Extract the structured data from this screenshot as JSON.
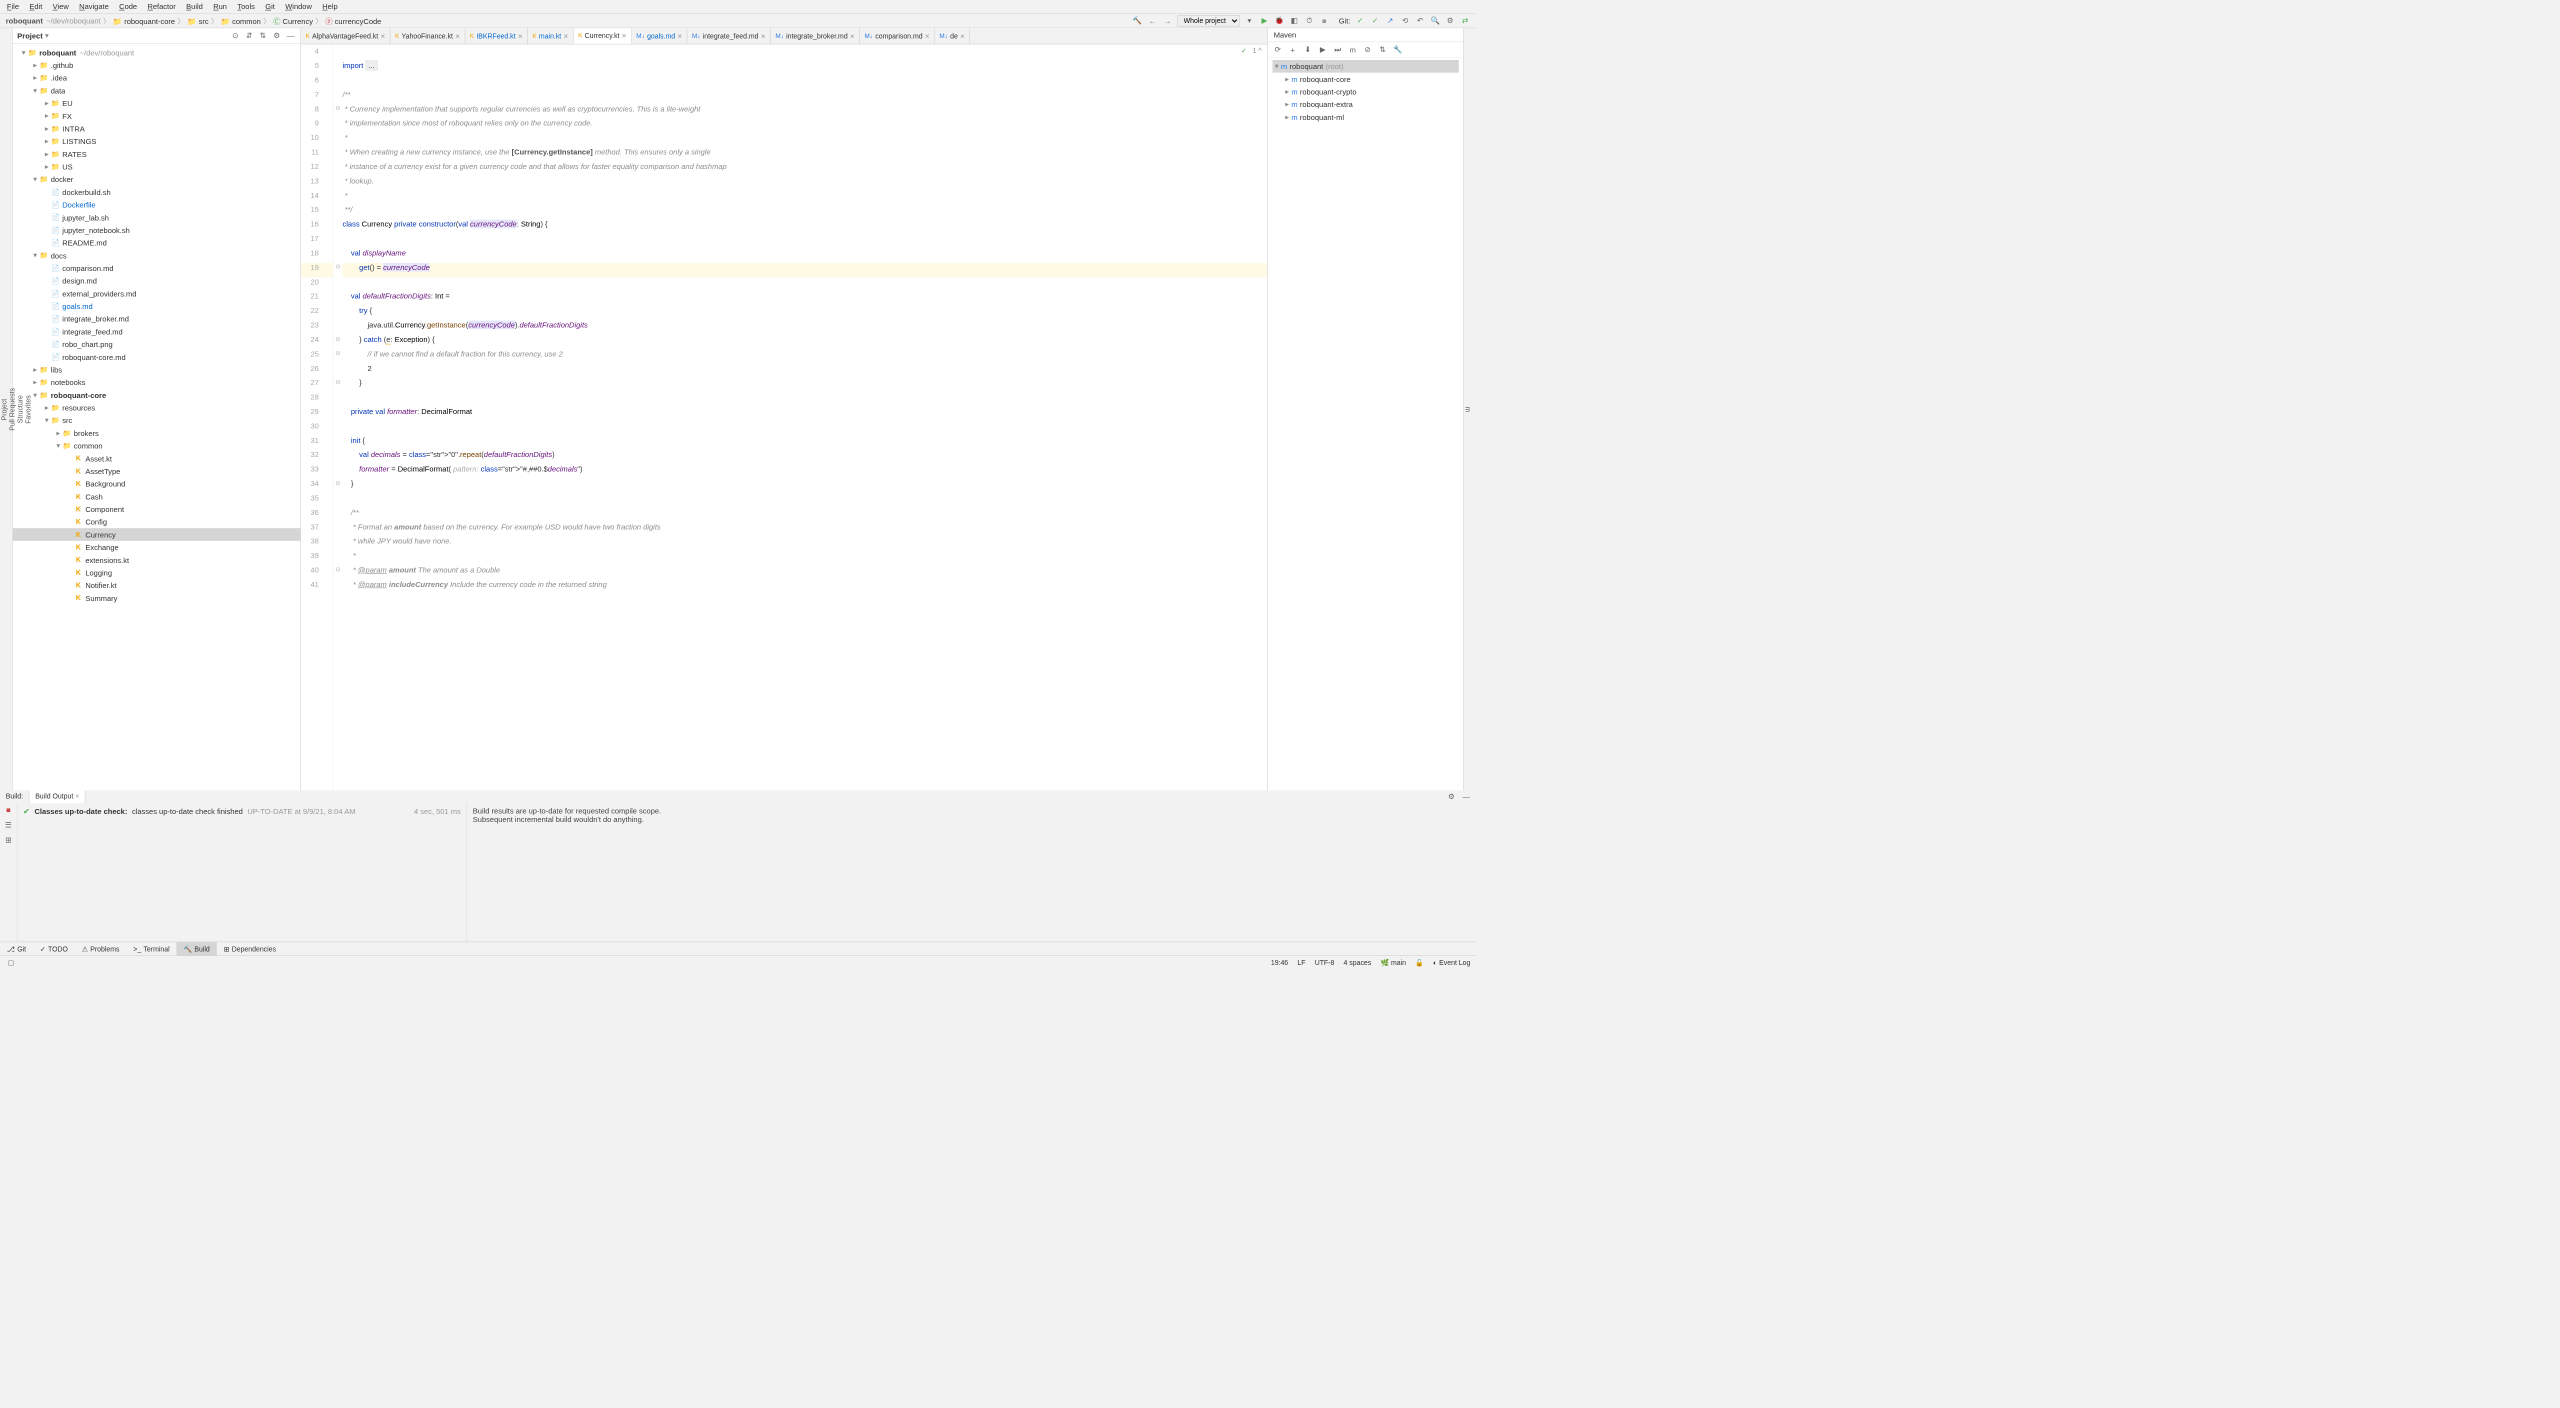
{
  "menu": [
    "File",
    "Edit",
    "View",
    "Navigate",
    "Code",
    "Refactor",
    "Build",
    "Run",
    "Tools",
    "Git",
    "Window",
    "Help"
  ],
  "breadcrumbs": {
    "root": "roboquant",
    "path": "~/dev/roboquant",
    "parts": [
      "roboquant-core",
      "src",
      "common",
      "Currency",
      "currencyCode"
    ]
  },
  "scope": "Whole project",
  "project": {
    "title": "Project",
    "tree": [
      {
        "d": 0,
        "c": "▾",
        "i": "📁",
        "n": "roboquant",
        "suf": "~/dev/roboquant",
        "bold": true
      },
      {
        "d": 1,
        "c": "▸",
        "i": "📁",
        "n": ".github"
      },
      {
        "d": 1,
        "c": "▸",
        "i": "📁",
        "n": ".idea"
      },
      {
        "d": 1,
        "c": "▾",
        "i": "📁",
        "n": "data"
      },
      {
        "d": 2,
        "c": "▸",
        "i": "📁",
        "n": "EU"
      },
      {
        "d": 2,
        "c": "▸",
        "i": "📁",
        "n": "FX"
      },
      {
        "d": 2,
        "c": "▸",
        "i": "📁",
        "n": "INTRA"
      },
      {
        "d": 2,
        "c": "▸",
        "i": "📁",
        "n": "LISTINGS"
      },
      {
        "d": 2,
        "c": "▸",
        "i": "📁",
        "n": "RATES"
      },
      {
        "d": 2,
        "c": "▸",
        "i": "📁",
        "n": "US"
      },
      {
        "d": 1,
        "c": "▾",
        "i": "📁",
        "n": "docker"
      },
      {
        "d": 2,
        "c": "",
        "i": "📄",
        "n": "dockerbuild.sh"
      },
      {
        "d": 2,
        "c": "",
        "i": "📄",
        "n": "Dockerfile",
        "hl": true
      },
      {
        "d": 2,
        "c": "",
        "i": "📄",
        "n": "jupyter_lab.sh"
      },
      {
        "d": 2,
        "c": "",
        "i": "📄",
        "n": "jupyter_notebook.sh"
      },
      {
        "d": 2,
        "c": "",
        "i": "📄",
        "n": "README.md"
      },
      {
        "d": 1,
        "c": "▾",
        "i": "📁",
        "n": "docs"
      },
      {
        "d": 2,
        "c": "",
        "i": "📄",
        "n": "comparison.md"
      },
      {
        "d": 2,
        "c": "",
        "i": "📄",
        "n": "design.md"
      },
      {
        "d": 2,
        "c": "",
        "i": "📄",
        "n": "external_providers.md"
      },
      {
        "d": 2,
        "c": "",
        "i": "📄",
        "n": "goals.md",
        "hl": true
      },
      {
        "d": 2,
        "c": "",
        "i": "📄",
        "n": "integrate_broker.md"
      },
      {
        "d": 2,
        "c": "",
        "i": "📄",
        "n": "integrate_feed.md"
      },
      {
        "d": 2,
        "c": "",
        "i": "📄",
        "n": "robo_chart.png"
      },
      {
        "d": 2,
        "c": "",
        "i": "📄",
        "n": "roboquant-core.md"
      },
      {
        "d": 1,
        "c": "▸",
        "i": "📁",
        "n": "libs"
      },
      {
        "d": 1,
        "c": "▸",
        "i": "📁",
        "n": "notebooks"
      },
      {
        "d": 1,
        "c": "▾",
        "i": "📁",
        "n": "roboquant-core",
        "bold": true
      },
      {
        "d": 2,
        "c": "▸",
        "i": "📁",
        "n": "resources"
      },
      {
        "d": 2,
        "c": "▾",
        "i": "📁",
        "n": "src"
      },
      {
        "d": 3,
        "c": "▸",
        "i": "📁",
        "n": "brokers"
      },
      {
        "d": 3,
        "c": "▾",
        "i": "📁",
        "n": "common"
      },
      {
        "d": 4,
        "c": "",
        "i": "K",
        "n": "Asset.kt"
      },
      {
        "d": 4,
        "c": "",
        "i": "K",
        "n": "AssetType"
      },
      {
        "d": 4,
        "c": "",
        "i": "K",
        "n": "Background"
      },
      {
        "d": 4,
        "c": "",
        "i": "K",
        "n": "Cash"
      },
      {
        "d": 4,
        "c": "",
        "i": "K",
        "n": "Component"
      },
      {
        "d": 4,
        "c": "",
        "i": "K",
        "n": "Config"
      },
      {
        "d": 4,
        "c": "",
        "i": "K",
        "n": "Currency",
        "sel": true
      },
      {
        "d": 4,
        "c": "",
        "i": "K",
        "n": "Exchange"
      },
      {
        "d": 4,
        "c": "",
        "i": "K",
        "n": "extensions.kt"
      },
      {
        "d": 4,
        "c": "",
        "i": "K",
        "n": "Logging"
      },
      {
        "d": 4,
        "c": "",
        "i": "K",
        "n": "Notifier.kt"
      },
      {
        "d": 4,
        "c": "",
        "i": "K",
        "n": "Summary"
      }
    ]
  },
  "tabs": [
    {
      "name": "AlphaVantageFeed.kt",
      "icon": "K"
    },
    {
      "name": "YahooFinance.kt",
      "icon": "K"
    },
    {
      "name": "IBKRFeed.kt",
      "icon": "K",
      "mod": true
    },
    {
      "name": "main.kt",
      "icon": "K",
      "mod": true
    },
    {
      "name": "Currency.kt",
      "icon": "K",
      "active": true
    },
    {
      "name": "goals.md",
      "icon": "M",
      "mod": true
    },
    {
      "name": "integrate_feed.md",
      "icon": "M"
    },
    {
      "name": "integrate_broker.md",
      "icon": "M"
    },
    {
      "name": "comparison.md",
      "icon": "M"
    },
    {
      "name": "de",
      "icon": "M"
    }
  ],
  "editor_status": {
    "checks": "1 ^",
    "hints": "✓"
  },
  "code_start": 4,
  "code_current": 19,
  "code": [
    "",
    "import ...",
    "",
    "/**",
    " * Currency implementation that supports regular currencies as well as cryptocurrencies. This is a lite-weight",
    " * implementation since most of roboquant relies only on the currency code.",
    " *",
    " * When creating a new currency instance, use the [Currency.getInstance] method. This ensures only a single",
    " * instance of a currency exist for a given currency code and that allows for faster equality comparison and hashmap",
    " * lookup.",
    " *",
    " **/",
    "class Currency private constructor(val currencyCode: String) {",
    "",
    "    val displayName",
    "        get() = currencyCode",
    "",
    "    val defaultFractionDigits: Int =",
    "        try {",
    "            java.util.Currency.getInstance(currencyCode).defaultFractionDigits",
    "        } catch (e: Exception) {",
    "            // if we cannot find a default fraction for this currency, use 2",
    "            2",
    "        }",
    "",
    "    private val formatter: DecimalFormat",
    "",
    "    init {",
    "        val decimals = \"0\".repeat(defaultFractionDigits)",
    "        formatter = DecimalFormat( pattern: \"#,##0.$decimals\")",
    "    }",
    "",
    "    /**",
    "     * Format an amount based on the currency. For example USD would have two fraction digits",
    "     * while JPY would have none.",
    "     *",
    "     * @param amount The amount as a Double",
    "     * @param includeCurrency Include the currency code in the returned string"
  ],
  "maven": {
    "title": "Maven",
    "tree": [
      {
        "d": 0,
        "c": "▾",
        "n": "roboquant",
        "suf": "(root)",
        "sel": true
      },
      {
        "d": 1,
        "c": "▸",
        "n": "roboquant-core"
      },
      {
        "d": 1,
        "c": "▸",
        "n": "roboquant-crypto"
      },
      {
        "d": 1,
        "c": "▸",
        "n": "roboquant-extra"
      },
      {
        "d": 1,
        "c": "▸",
        "n": "roboquant-ml"
      }
    ]
  },
  "build": {
    "tabs": [
      "Build:",
      "Build Output"
    ],
    "row_title": "Classes up-to-date check:",
    "row_msg": "classes up-to-date check finished",
    "row_status": "UP-TO-DATE at 9/9/21, 8:04 AM",
    "row_time": "4 sec, 501 ms",
    "output1": "Build results are up-to-date for requested compile scope.",
    "output2": "Subsequent incremental build wouldn't do anything."
  },
  "bottom_tabs": [
    "Git",
    "TODO",
    "Problems",
    "Terminal",
    "Build",
    "Dependencies"
  ],
  "bottom_active": "Build",
  "status": {
    "pos": "19:46",
    "le": "LF",
    "enc": "UTF-8",
    "indent": "4 spaces",
    "branch": "main",
    "event": "Event Log"
  }
}
